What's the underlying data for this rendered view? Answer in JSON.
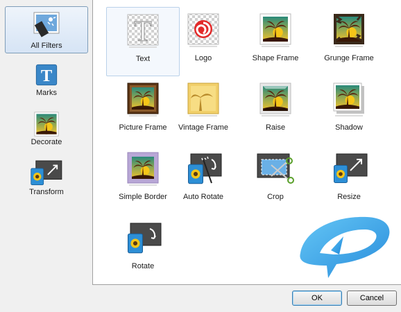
{
  "categories": [
    {
      "label": "All Filters",
      "icon": "all-filters-icon",
      "selected": true
    },
    {
      "label": "Marks",
      "icon": "text-t-icon",
      "selected": false
    },
    {
      "label": "Decorate",
      "icon": "palm-photo-icon",
      "selected": false
    },
    {
      "label": "Transform",
      "icon": "transform-resize-icon",
      "selected": false
    }
  ],
  "filters": [
    {
      "label": "Text",
      "icon": "text-t-icon",
      "selected": true
    },
    {
      "label": "Logo",
      "icon": "logo-swirl-icon"
    },
    {
      "label": "Shape Frame",
      "icon": "shape-frame-icon"
    },
    {
      "label": "Grunge Frame",
      "icon": "grunge-frame-icon"
    },
    {
      "label": "Picture Frame",
      "icon": "picture-frame-icon"
    },
    {
      "label": "Vintage Frame",
      "icon": "vintage-frame-icon"
    },
    {
      "label": "Raise",
      "icon": "raise-icon"
    },
    {
      "label": "Shadow",
      "icon": "shadow-icon"
    },
    {
      "label": "Simple Border",
      "icon": "simple-border-icon"
    },
    {
      "label": "Auto Rotate",
      "icon": "auto-rotate-icon"
    },
    {
      "label": "Crop",
      "icon": "crop-icon"
    },
    {
      "label": "Resize",
      "icon": "resize-icon"
    },
    {
      "label": "Rotate",
      "icon": "rotate-icon"
    }
  ],
  "buttons": {
    "ok": "OK",
    "cancel": "Cancel"
  },
  "colors": {
    "accent": "#3c7fb1",
    "watermark": "#2aa0e8",
    "sun": "#f5c518",
    "palm": "#5a2a10"
  }
}
